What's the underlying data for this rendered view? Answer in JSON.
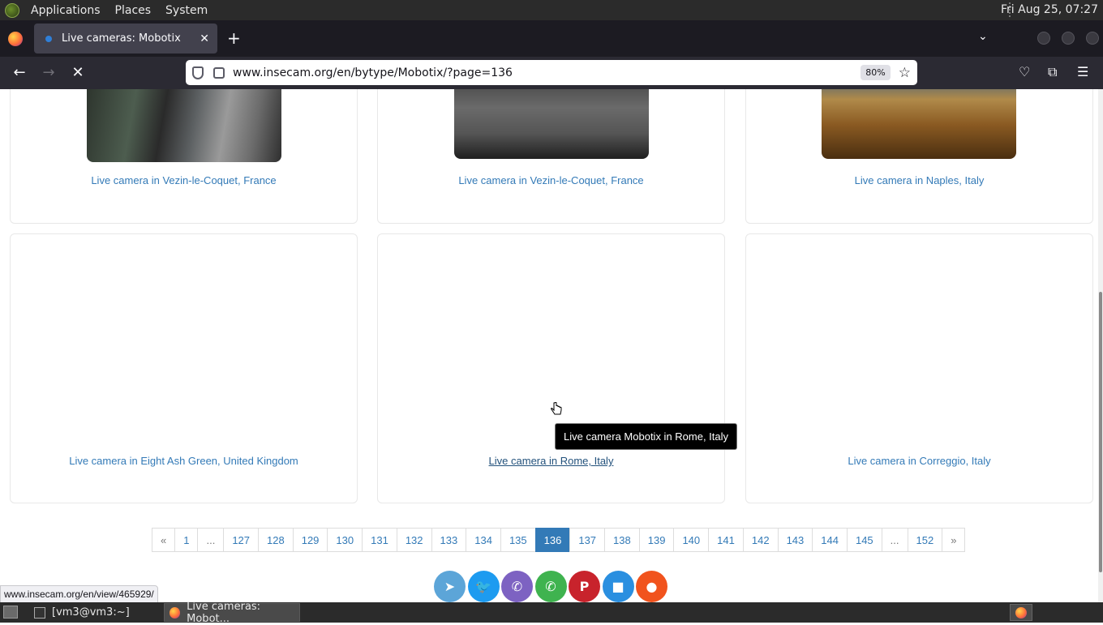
{
  "top_panel": {
    "menus": [
      "Applications",
      "Places",
      "System"
    ],
    "clock": "Fri Aug 25, 07:27"
  },
  "browser": {
    "tab_title": "Live cameras: Mobotix",
    "url": "www.insecam.org/en/bytype/Mobotix/?page=136",
    "zoom": "80%"
  },
  "cards": [
    {
      "label": "Live camera in Vezin-le-Coquet, France"
    },
    {
      "label": "Live camera in Vezin-le-Coquet, France"
    },
    {
      "label": "Live camera in Naples, Italy"
    },
    {
      "label": "Live camera in Eight Ash Green, United Kingdom"
    },
    {
      "label": "Live camera in Rome, Italy"
    },
    {
      "label": "Live camera in Correggio, Italy"
    }
  ],
  "tooltip": "Live camera Mobotix in Rome, Italy",
  "pagination": {
    "pages": [
      "«",
      "1",
      "...",
      "127",
      "128",
      "129",
      "130",
      "131",
      "132",
      "133",
      "134",
      "135",
      "136",
      "137",
      "138",
      "139",
      "140",
      "141",
      "142",
      "143",
      "144",
      "145",
      "...",
      "152",
      "»"
    ],
    "active": "136"
  },
  "share_buttons": [
    {
      "name": "telegram",
      "color": "#5ca5d8"
    },
    {
      "name": "twitter",
      "color": "#1d9bf0"
    },
    {
      "name": "viber",
      "color": "#7d62c2"
    },
    {
      "name": "whatsapp",
      "color": "#3fb34f"
    },
    {
      "name": "pinterest",
      "color": "#c8232c"
    },
    {
      "name": "delicious",
      "color": "#2a8fe0"
    },
    {
      "name": "reddit",
      "color": "#f1531d"
    }
  ],
  "status_url": "www.insecam.org/en/view/465929/",
  "taskbar": {
    "terminal_task": "[vm3@vm3:~]",
    "browser_task": "Live cameras: Mobot..."
  }
}
